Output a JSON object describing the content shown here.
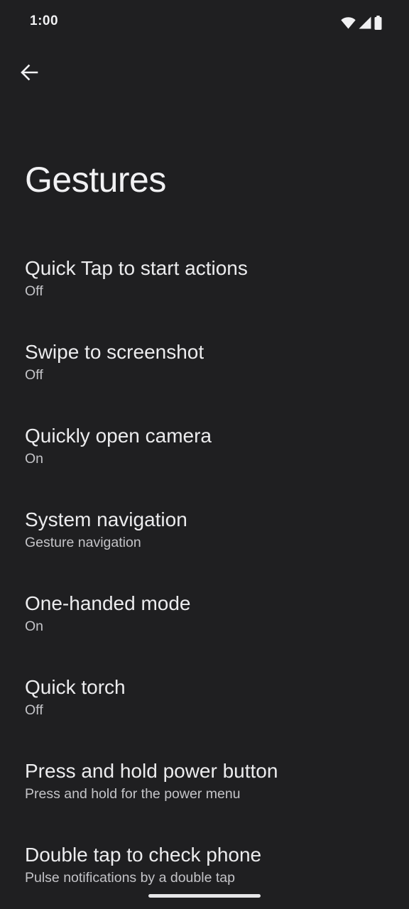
{
  "status_bar": {
    "time": "1:00",
    "icons": [
      "wifi-icon",
      "signal-icon",
      "battery-icon"
    ]
  },
  "header": {
    "back_icon": "arrow-back-icon"
  },
  "page": {
    "title": "Gestures"
  },
  "settings": [
    {
      "title": "Quick Tap to start actions",
      "summary": "Off"
    },
    {
      "title": "Swipe to screenshot",
      "summary": "Off"
    },
    {
      "title": "Quickly open camera",
      "summary": "On"
    },
    {
      "title": "System navigation",
      "summary": "Gesture navigation"
    },
    {
      "title": "One-handed mode",
      "summary": "On"
    },
    {
      "title": "Quick torch",
      "summary": "Off"
    },
    {
      "title": "Press and hold power button",
      "summary": "Press and hold for the power menu"
    },
    {
      "title": "Double tap to check phone",
      "summary": "Pulse notifications by a double tap"
    }
  ],
  "colors": {
    "background": "#1f1f21",
    "text_primary": "#ececee",
    "text_secondary": "#c4c4c8"
  }
}
